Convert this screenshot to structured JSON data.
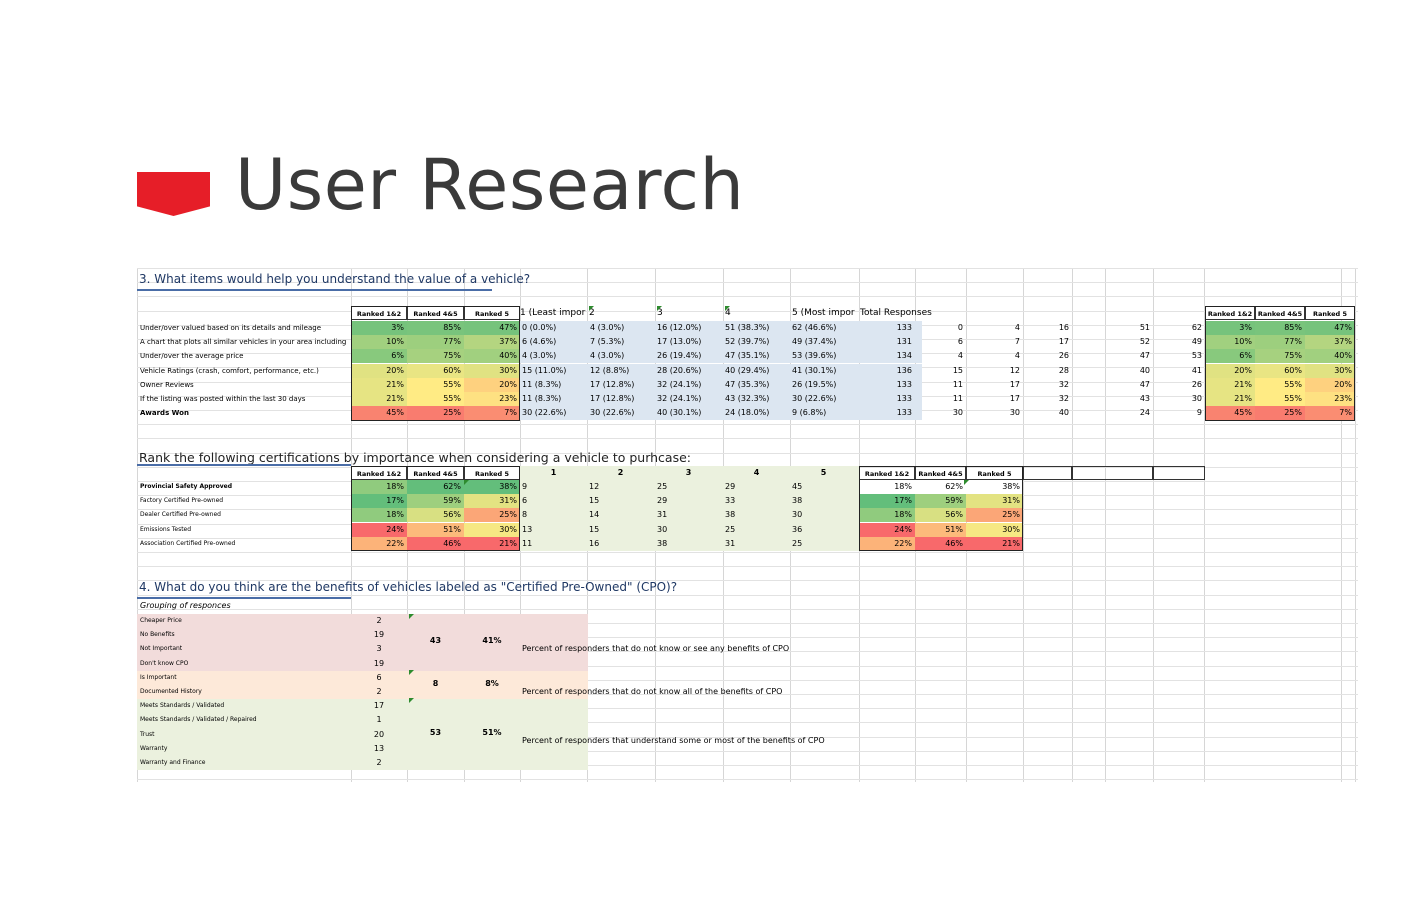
{
  "title": "User Research",
  "colors": {
    "accent": "#e61e28",
    "title_text": "#3a3a3a",
    "light_blue": "#dce6f1",
    "light_pink": "#f2dcdb",
    "light_peach": "#fde9d9",
    "light_green": "#ebf1de"
  },
  "section1": {
    "question": "3. What items would help you understand the value of a vehicle?",
    "headers": [
      "Ranked 1&2",
      "Ranked 4&5",
      "Ranked 5",
      "1 (Least impor",
      "2",
      "3",
      "4",
      "5 (Most impor",
      "Total Responses"
    ],
    "right_headers": [
      "Ranked 1&2",
      "Ranked 4&5",
      "Ranked 5"
    ],
    "rows": [
      {
        "label": "Under/over valued based on its details and mileage",
        "r12": "3%",
        "r45": "85%",
        "r5": "47%",
        "c1": "0 (0.0%)",
        "c2": "4 (3.0%)",
        "c3": "16 (12.0%)",
        "c4": "51 (38.3%)",
        "c5": "62 (46.6%)",
        "total": "133",
        "n1": "0",
        "n2": "4",
        "n3": "16",
        "n4": "51",
        "n5": "62",
        "rr12": "3%",
        "rr45": "85%",
        "rr5": "47%"
      },
      {
        "label": "A chart that plots all similar vehicles in your area including",
        "r12": "10%",
        "r45": "77%",
        "r5": "37%",
        "c1": "6 (4.6%)",
        "c2": "7 (5.3%)",
        "c3": "17 (13.0%)",
        "c4": "52 (39.7%)",
        "c5": "49 (37.4%)",
        "total": "131",
        "n1": "6",
        "n2": "7",
        "n3": "17",
        "n4": "52",
        "n5": "49",
        "rr12": "10%",
        "rr45": "77%",
        "rr5": "37%"
      },
      {
        "label": "Under/over the average price",
        "r12": "6%",
        "r45": "75%",
        "r5": "40%",
        "c1": "4 (3.0%)",
        "c2": "4 (3.0%)",
        "c3": "26 (19.4%)",
        "c4": "47 (35.1%)",
        "c5": "53 (39.6%)",
        "total": "134",
        "n1": "4",
        "n2": "4",
        "n3": "26",
        "n4": "47",
        "n5": "53",
        "rr12": "6%",
        "rr45": "75%",
        "rr5": "40%"
      },
      {
        "label": "Vehicle Ratings (crash, comfort, performance, etc.)",
        "r12": "20%",
        "r45": "60%",
        "r5": "30%",
        "c1": "15 (11.0%)",
        "c2": "12 (8.8%)",
        "c3": "28 (20.6%)",
        "c4": "40 (29.4%)",
        "c5": "41 (30.1%)",
        "total": "136",
        "n1": "15",
        "n2": "12",
        "n3": "28",
        "n4": "40",
        "n5": "41",
        "rr12": "20%",
        "rr45": "60%",
        "rr5": "30%"
      },
      {
        "label": "Owner Reviews",
        "r12": "21%",
        "r45": "55%",
        "r5": "20%",
        "c1": "11 (8.3%)",
        "c2": "17 (12.8%)",
        "c3": "32 (24.1%)",
        "c4": "47 (35.3%)",
        "c5": "26 (19.5%)",
        "total": "133",
        "n1": "11",
        "n2": "17",
        "n3": "32",
        "n4": "47",
        "n5": "26",
        "rr12": "21%",
        "rr45": "55%",
        "rr5": "20%"
      },
      {
        "label": "If the listing was posted within the last 30 days",
        "r12": "21%",
        "r45": "55%",
        "r5": "23%",
        "c1": "11 (8.3%)",
        "c2": "17 (12.8%)",
        "c3": "32 (24.1%)",
        "c4": "43 (32.3%)",
        "c5": "30 (22.6%)",
        "total": "133",
        "n1": "11",
        "n2": "17",
        "n3": "32",
        "n4": "43",
        "n5": "30",
        "rr12": "21%",
        "rr45": "55%",
        "rr5": "23%"
      },
      {
        "label": "Awards Won",
        "r12": "45%",
        "r45": "25%",
        "r5": "7%",
        "c1": "30 (22.6%)",
        "c2": "30 (22.6%)",
        "c3": "40 (30.1%)",
        "c4": "24 (18.0%)",
        "c5": "9 (6.8%)",
        "total": "133",
        "n1": "30",
        "n2": "30",
        "n3": "40",
        "n4": "24",
        "n5": "9",
        "rr12": "45%",
        "rr45": "25%",
        "rr5": "7%"
      }
    ]
  },
  "section2": {
    "question": "Rank the following certifications by importance when considering a vehicle to purhcase:",
    "headers": [
      "Ranked 1&2",
      "Ranked 4&5",
      "Ranked 5",
      "1",
      "2",
      "3",
      "4",
      "5",
      "Ranked 1&2",
      "Ranked 4&5",
      "Ranked 5"
    ],
    "rows": [
      {
        "label": "Provincial Safety Approved",
        "r12": "18%",
        "r45": "62%",
        "r5": "38%",
        "c1": "9",
        "c2": "12",
        "c3": "25",
        "c4": "29",
        "c5": "45",
        "rr12": "18%",
        "rr45": "62%",
        "rr5": "38%"
      },
      {
        "label": "Factory Certified Pre-owned",
        "r12": "17%",
        "r45": "59%",
        "r5": "31%",
        "c1": "6",
        "c2": "15",
        "c3": "29",
        "c4": "33",
        "c5": "38",
        "rr12": "17%",
        "rr45": "59%",
        "rr5": "31%"
      },
      {
        "label": "Dealer Certified Pre-owned",
        "r12": "18%",
        "r45": "56%",
        "r5": "25%",
        "c1": "8",
        "c2": "14",
        "c3": "31",
        "c4": "38",
        "c5": "30",
        "rr12": "18%",
        "rr45": "56%",
        "rr5": "25%"
      },
      {
        "label": "Emissions Tested",
        "r12": "24%",
        "r45": "51%",
        "r5": "30%",
        "c1": "13",
        "c2": "15",
        "c3": "30",
        "c4": "25",
        "c5": "36",
        "rr12": "24%",
        "rr45": "51%",
        "rr5": "30%"
      },
      {
        "label": "Association Certified Pre-owned",
        "r12": "22%",
        "r45": "46%",
        "r5": "21%",
        "c1": "11",
        "c2": "16",
        "c3": "38",
        "c4": "31",
        "c5": "25",
        "rr12": "22%",
        "rr45": "46%",
        "rr5": "21%"
      }
    ]
  },
  "section3": {
    "question": "4. What do you think are the benefits of vehicles labeled as \"Certified Pre-Owned\" (CPO)?",
    "grouping_label": "Grouping of responces",
    "rows": [
      {
        "label": "Cheaper Price",
        "value": "2"
      },
      {
        "label": "No Benefits",
        "value": "19"
      },
      {
        "label": "Not Important",
        "value": "3"
      },
      {
        "label": "Don't know CPO",
        "value": "19"
      },
      {
        "label": "Is Important",
        "value": "6"
      },
      {
        "label": "Documented History",
        "value": "2"
      },
      {
        "label": "Meets Standards / Validated",
        "value": "17"
      },
      {
        "label": "Meets Standards / Validated / Repaired",
        "value": "1"
      },
      {
        "label": "Trust",
        "value": "20"
      },
      {
        "label": "Warranty",
        "value": "13"
      },
      {
        "label": "Warranty and Finance",
        "value": "2"
      }
    ],
    "groups": [
      {
        "count": "43",
        "pct": "41%",
        "note": "Percent of responders that do not know or see any benefits of CPO"
      },
      {
        "count": "8",
        "pct": "8%",
        "note": "Percent of responders that do not know all of the benefits of CPO"
      },
      {
        "count": "53",
        "pct": "51%",
        "note": "Percent of responders that understand some or most of the benefits of CPO"
      }
    ]
  }
}
